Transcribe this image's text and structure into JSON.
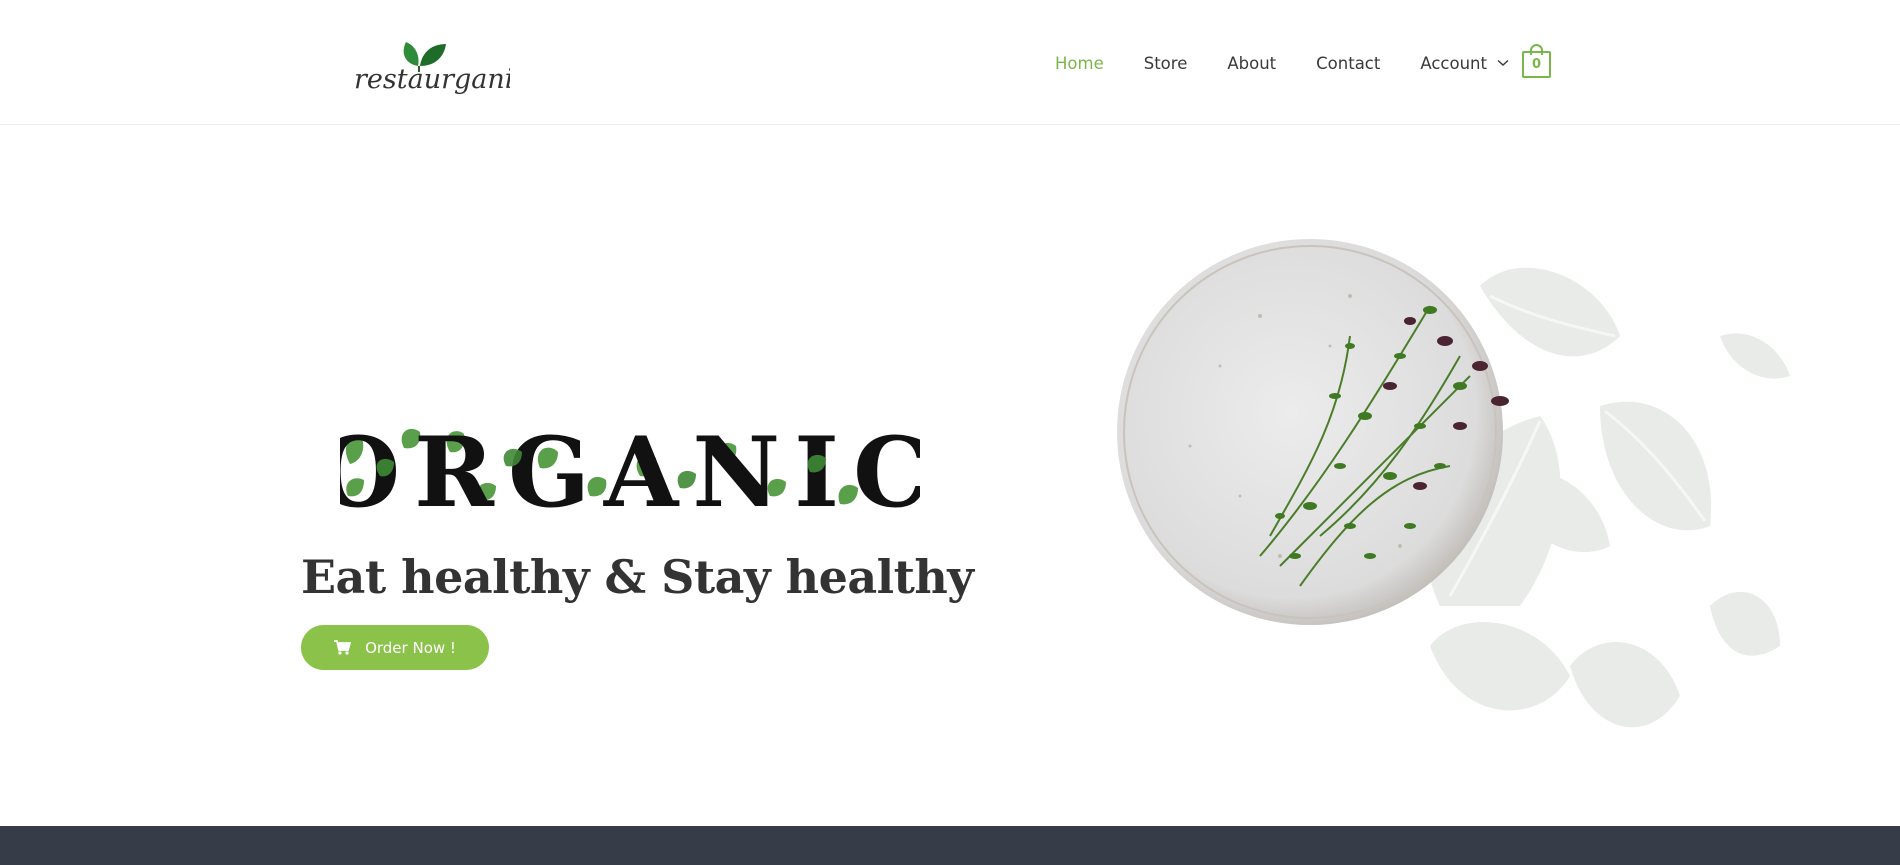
{
  "header": {
    "logo_text": "restaurganic",
    "nav": [
      {
        "label": "Home",
        "active": true
      },
      {
        "label": "Store",
        "active": false
      },
      {
        "label": "About",
        "active": false
      },
      {
        "label": "Contact",
        "active": false
      },
      {
        "label": "Account",
        "active": false,
        "has_dropdown": true
      }
    ],
    "cart_count": "0"
  },
  "hero": {
    "display_word": "ORGANIC",
    "tagline": "Eat healthy & Stay healthy",
    "cta_label": "Order Now !",
    "cta_icon": "cart-icon"
  },
  "colors": {
    "accent": "#7ab648",
    "button": "#8bc34a",
    "text": "#3a3a3a",
    "heading": "#333333",
    "footer_band": "#363c48"
  }
}
